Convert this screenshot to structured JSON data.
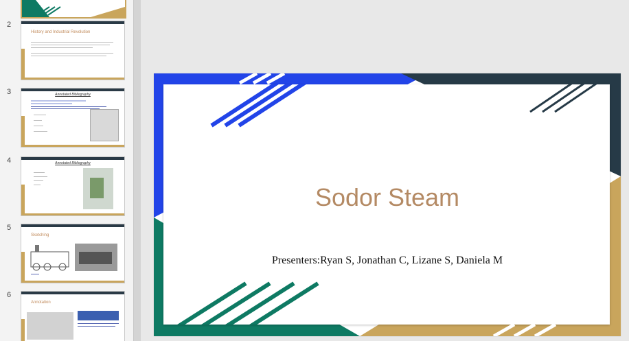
{
  "panel": {
    "slides": [
      {
        "number": "2",
        "title": "History and Industrial Revolution"
      },
      {
        "number": "3",
        "title": "Annotated Bibliography"
      },
      {
        "number": "4",
        "title": "Annotated Bibliography"
      },
      {
        "number": "5",
        "title": "Sketching"
      },
      {
        "number": "6",
        "title": "Annotation"
      }
    ]
  },
  "slide": {
    "title": "Sodor Steam",
    "subtitle": "Presenters:Ryan S, Jonathan C, Lizane S, Daniela M"
  },
  "colors": {
    "blue": "#2244e8",
    "navy": "#263a47",
    "green": "#0e7a63",
    "gold": "#c9a55c",
    "title": "#b48a64"
  }
}
